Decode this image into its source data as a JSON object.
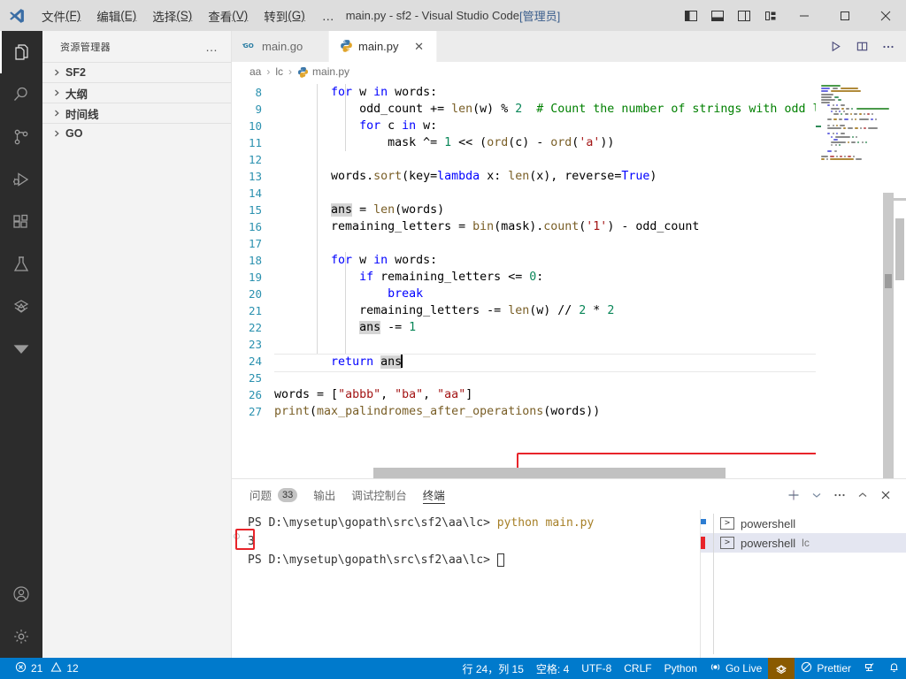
{
  "titlebar": {
    "menus": [
      {
        "label": "文件",
        "accel": "(F)"
      },
      {
        "label": "编辑",
        "accel": "(E)"
      },
      {
        "label": "选择",
        "accel": "(S)"
      },
      {
        "label": "查看",
        "accel": "(V)"
      },
      {
        "label": "转到",
        "accel": "(G)"
      }
    ],
    "overflow": "…",
    "title_main": "main.py - sf2 - Visual Studio Code ",
    "title_admin": "[管理员]",
    "layout_buttons": [
      "toggle-primary-sidebar",
      "toggle-panel",
      "toggle-secondary-sidebar",
      "customize-layout"
    ],
    "window_buttons": {
      "minimize": "—",
      "maximize": "▢",
      "close": "✕"
    }
  },
  "activitybar": {
    "items": [
      {
        "name": "explorer",
        "active": true
      },
      {
        "name": "search",
        "active": false
      },
      {
        "name": "source-control",
        "active": false
      },
      {
        "name": "run-and-debug",
        "active": false
      },
      {
        "name": "extensions",
        "active": false
      },
      {
        "name": "testing",
        "active": false
      },
      {
        "name": "go-extension",
        "active": false
      },
      {
        "name": "collapse-more",
        "active": false
      }
    ],
    "bottom": [
      {
        "name": "accounts"
      },
      {
        "name": "manage-settings"
      }
    ]
  },
  "sidebar": {
    "title": "资源管理器",
    "more": "…",
    "sections": [
      {
        "label": "SF2",
        "expanded": false
      },
      {
        "label": "大纲",
        "expanded": false
      },
      {
        "label": "时间线",
        "expanded": false
      },
      {
        "label": "GO",
        "expanded": false
      }
    ]
  },
  "editor": {
    "tabs": [
      {
        "label": "main.go",
        "icon": "go-icon",
        "active": false,
        "closable": false
      },
      {
        "label": "main.py",
        "icon": "python-icon",
        "active": true,
        "closable": true,
        "close": "✕"
      }
    ],
    "tab_actions": [
      "run-python-file",
      "split-editor-right",
      "more-actions"
    ],
    "breadcrumbs": [
      "aa",
      "lc",
      "main.py"
    ],
    "breadcrumb_sep": "›",
    "first_visible_line": 8,
    "lines": [
      {
        "n": 8,
        "tokens": [
          {
            "t": "        ",
            "c": "op"
          },
          {
            "t": "for",
            "c": "k"
          },
          {
            "t": " w ",
            "c": "op"
          },
          {
            "t": "in",
            "c": "k"
          },
          {
            "t": " words:",
            "c": "op"
          }
        ]
      },
      {
        "n": 9,
        "tokens": [
          {
            "t": "            odd_count += ",
            "c": "op"
          },
          {
            "t": "len",
            "c": "fn"
          },
          {
            "t": "(w) % ",
            "c": "op"
          },
          {
            "t": "2",
            "c": "num"
          },
          {
            "t": "  ",
            "c": "op"
          },
          {
            "t": "# Count the number of strings with odd lengt",
            "c": "cm"
          }
        ]
      },
      {
        "n": 10,
        "tokens": [
          {
            "t": "            ",
            "c": "op"
          },
          {
            "t": "for",
            "c": "k"
          },
          {
            "t": " c ",
            "c": "op"
          },
          {
            "t": "in",
            "c": "k"
          },
          {
            "t": " w:",
            "c": "op"
          }
        ]
      },
      {
        "n": 11,
        "tokens": [
          {
            "t": "                mask ^= ",
            "c": "op"
          },
          {
            "t": "1",
            "c": "num"
          },
          {
            "t": " << (",
            "c": "op"
          },
          {
            "t": "ord",
            "c": "fn"
          },
          {
            "t": "(c) - ",
            "c": "op"
          },
          {
            "t": "ord",
            "c": "fn"
          },
          {
            "t": "(",
            "c": "op"
          },
          {
            "t": "'a'",
            "c": "st"
          },
          {
            "t": "))",
            "c": "op"
          }
        ]
      },
      {
        "n": 12,
        "tokens": []
      },
      {
        "n": 13,
        "tokens": [
          {
            "t": "        words.",
            "c": "op"
          },
          {
            "t": "sort",
            "c": "fn"
          },
          {
            "t": "(key=",
            "c": "op"
          },
          {
            "t": "lambda",
            "c": "k"
          },
          {
            "t": " x: ",
            "c": "op"
          },
          {
            "t": "len",
            "c": "fn"
          },
          {
            "t": "(x), reverse=",
            "c": "op"
          },
          {
            "t": "True",
            "c": "k"
          },
          {
            "t": ")",
            "c": "op"
          }
        ]
      },
      {
        "n": 14,
        "tokens": []
      },
      {
        "n": 15,
        "tokens": [
          {
            "t": "        ",
            "c": "op"
          },
          {
            "t": "ans",
            "c": "sel"
          },
          {
            "t": " = ",
            "c": "op"
          },
          {
            "t": "len",
            "c": "fn"
          },
          {
            "t": "(words)",
            "c": "op"
          }
        ]
      },
      {
        "n": 16,
        "tokens": [
          {
            "t": "        remaining_letters = ",
            "c": "op"
          },
          {
            "t": "bin",
            "c": "fn"
          },
          {
            "t": "(mask).",
            "c": "op"
          },
          {
            "t": "count",
            "c": "fn"
          },
          {
            "t": "(",
            "c": "op"
          },
          {
            "t": "'1'",
            "c": "st"
          },
          {
            "t": ") - odd_count",
            "c": "op"
          }
        ]
      },
      {
        "n": 17,
        "tokens": []
      },
      {
        "n": 18,
        "tokens": [
          {
            "t": "        ",
            "c": "op"
          },
          {
            "t": "for",
            "c": "k"
          },
          {
            "t": " w ",
            "c": "op"
          },
          {
            "t": "in",
            "c": "k"
          },
          {
            "t": " words:",
            "c": "op"
          }
        ]
      },
      {
        "n": 19,
        "tokens": [
          {
            "t": "            ",
            "c": "op"
          },
          {
            "t": "if",
            "c": "k"
          },
          {
            "t": " remaining_letters <= ",
            "c": "op"
          },
          {
            "t": "0",
            "c": "num"
          },
          {
            "t": ":",
            "c": "op"
          }
        ]
      },
      {
        "n": 20,
        "tokens": [
          {
            "t": "                ",
            "c": "op"
          },
          {
            "t": "break",
            "c": "k"
          }
        ]
      },
      {
        "n": 21,
        "tokens": [
          {
            "t": "            remaining_letters -= ",
            "c": "op"
          },
          {
            "t": "len",
            "c": "fn"
          },
          {
            "t": "(w) // ",
            "c": "op"
          },
          {
            "t": "2",
            "c": "num"
          },
          {
            "t": " * ",
            "c": "op"
          },
          {
            "t": "2",
            "c": "num"
          }
        ]
      },
      {
        "n": 22,
        "tokens": [
          {
            "t": "            ",
            "c": "op"
          },
          {
            "t": "ans",
            "c": "sel"
          },
          {
            "t": " -= ",
            "c": "op"
          },
          {
            "t": "1",
            "c": "num"
          }
        ]
      },
      {
        "n": 23,
        "tokens": []
      },
      {
        "n": 24,
        "tokens": [
          {
            "t": "        ",
            "c": "op"
          },
          {
            "t": "return",
            "c": "k"
          },
          {
            "t": " ",
            "c": "op"
          },
          {
            "t": "ans",
            "c": "sel"
          }
        ],
        "current": true,
        "caret": true
      },
      {
        "n": 25,
        "tokens": []
      },
      {
        "n": 26,
        "tokens": [
          {
            "t": "words = [",
            "c": "op"
          },
          {
            "t": "\"abbb\"",
            "c": "st"
          },
          {
            "t": ", ",
            "c": "op"
          },
          {
            "t": "\"ba\"",
            "c": "st"
          },
          {
            "t": ", ",
            "c": "op"
          },
          {
            "t": "\"aa\"",
            "c": "st"
          },
          {
            "t": "]",
            "c": "op"
          }
        ]
      },
      {
        "n": 27,
        "tokens": [
          {
            "t": "print",
            "c": "fn"
          },
          {
            "t": "(",
            "c": "op"
          },
          {
            "t": "max_palindromes_after_operations",
            "c": "fn"
          },
          {
            "t": "(words))",
            "c": "op"
          }
        ]
      }
    ],
    "highlight_box_color": "#e8242a"
  },
  "panel": {
    "tabs": [
      {
        "label": "问题",
        "badge": "33",
        "active": false
      },
      {
        "label": "输出",
        "badge": null,
        "active": false
      },
      {
        "label": "调试控制台",
        "badge": null,
        "active": false
      },
      {
        "label": "终端",
        "badge": null,
        "active": true
      }
    ],
    "actions": [
      "new-terminal",
      "terminal-profile-chevron",
      "more-actions",
      "maximize-panel",
      "close-panel"
    ],
    "action_glyphs": {
      "plus": "＋",
      "chevron": "⌄",
      "dots": "…",
      "chevron_up": "⌃",
      "close": "✕"
    },
    "terminal_lines": [
      {
        "type": "prompt",
        "prompt": "PS D:\\mysetup\\gopath\\src\\sf2\\aa\\lc> ",
        "command": "python main.py"
      },
      {
        "type": "output",
        "text": "3",
        "boxed": true
      },
      {
        "type": "prompt",
        "prompt": "PS D:\\mysetup\\gopath\\src\\sf2\\aa\\lc> ",
        "command": "",
        "cursor": true
      }
    ],
    "terminal_list": [
      {
        "label": "powershell",
        "sub": "",
        "active": false
      },
      {
        "label": "powershell",
        "sub": "lc",
        "active": true
      }
    ]
  },
  "statusbar": {
    "left": [
      {
        "name": "errors-warnings",
        "error_icon": "⊗",
        "errors": "21",
        "warning_icon": "⚠",
        "warnings": "12"
      }
    ],
    "right": [
      {
        "name": "cursor-position",
        "label": "行 24，列 15"
      },
      {
        "name": "indentation",
        "label": "空格: 4"
      },
      {
        "name": "encoding",
        "label": "UTF-8"
      },
      {
        "name": "eol",
        "label": "CRLF"
      },
      {
        "name": "language-mode",
        "label": "Python"
      },
      {
        "name": "go-live",
        "label": "Go Live",
        "icon": "broadcast-icon"
      },
      {
        "name": "go-extension-status",
        "label": "",
        "icon": "gopher-icon",
        "highlight": true
      },
      {
        "name": "prettier",
        "label": "Prettier",
        "icon": "prohibited-icon"
      },
      {
        "name": "remote-indicator",
        "label": "",
        "icon": "remote-icon"
      },
      {
        "name": "notifications",
        "label": "",
        "icon": "bell-icon"
      }
    ],
    "accent": "#007acc",
    "highlight_bg": "#8a5a00"
  }
}
